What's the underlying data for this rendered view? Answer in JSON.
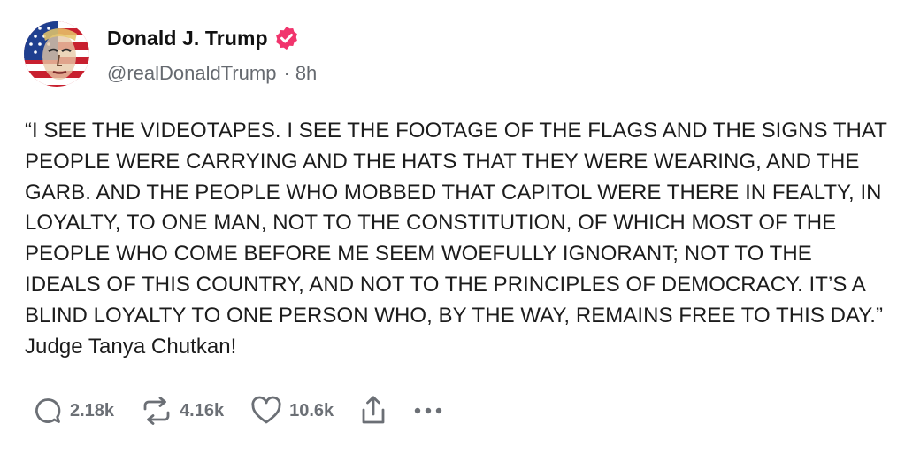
{
  "author": {
    "display_name": "Donald J. Trump",
    "handle": "@realDonaldTrump",
    "separator": "·",
    "time_ago": "8h",
    "verified_icon": "verified-badge-icon",
    "verified_color": "#f1356d"
  },
  "post": {
    "text": "“I SEE THE VIDEOTAPES. I SEE THE FOOTAGE OF THE FLAGS AND THE SIGNS THAT PEOPLE WERE CARRYING AND THE HATS THAT THEY WERE WEARING, AND THE GARB. AND THE PEOPLE WHO MOBBED THAT CAPITOL WERE THERE IN FEALTY, IN LOYALTY, TO ONE MAN, NOT TO THE CONSTITUTION, OF WHICH MOST OF THE PEOPLE WHO COME BEFORE ME SEEM WOEFULLY IGNORANT; NOT TO THE IDEALS OF THIS COUNTRY, AND NOT TO THE PRINCIPLES OF DEMOCRACY. IT’S A BLIND LOYALTY TO ONE PERSON WHO, BY THE WAY, REMAINS FREE TO THIS DAY.” Judge Tanya Chutkan!"
  },
  "actions": {
    "replies": {
      "icon": "reply-icon",
      "count": "2.18k"
    },
    "retruths": {
      "icon": "repost-icon",
      "count": "4.16k"
    },
    "likes": {
      "icon": "heart-icon",
      "count": "10.6k"
    },
    "share": {
      "icon": "share-icon"
    },
    "more": {
      "icon": "more-icon"
    }
  }
}
